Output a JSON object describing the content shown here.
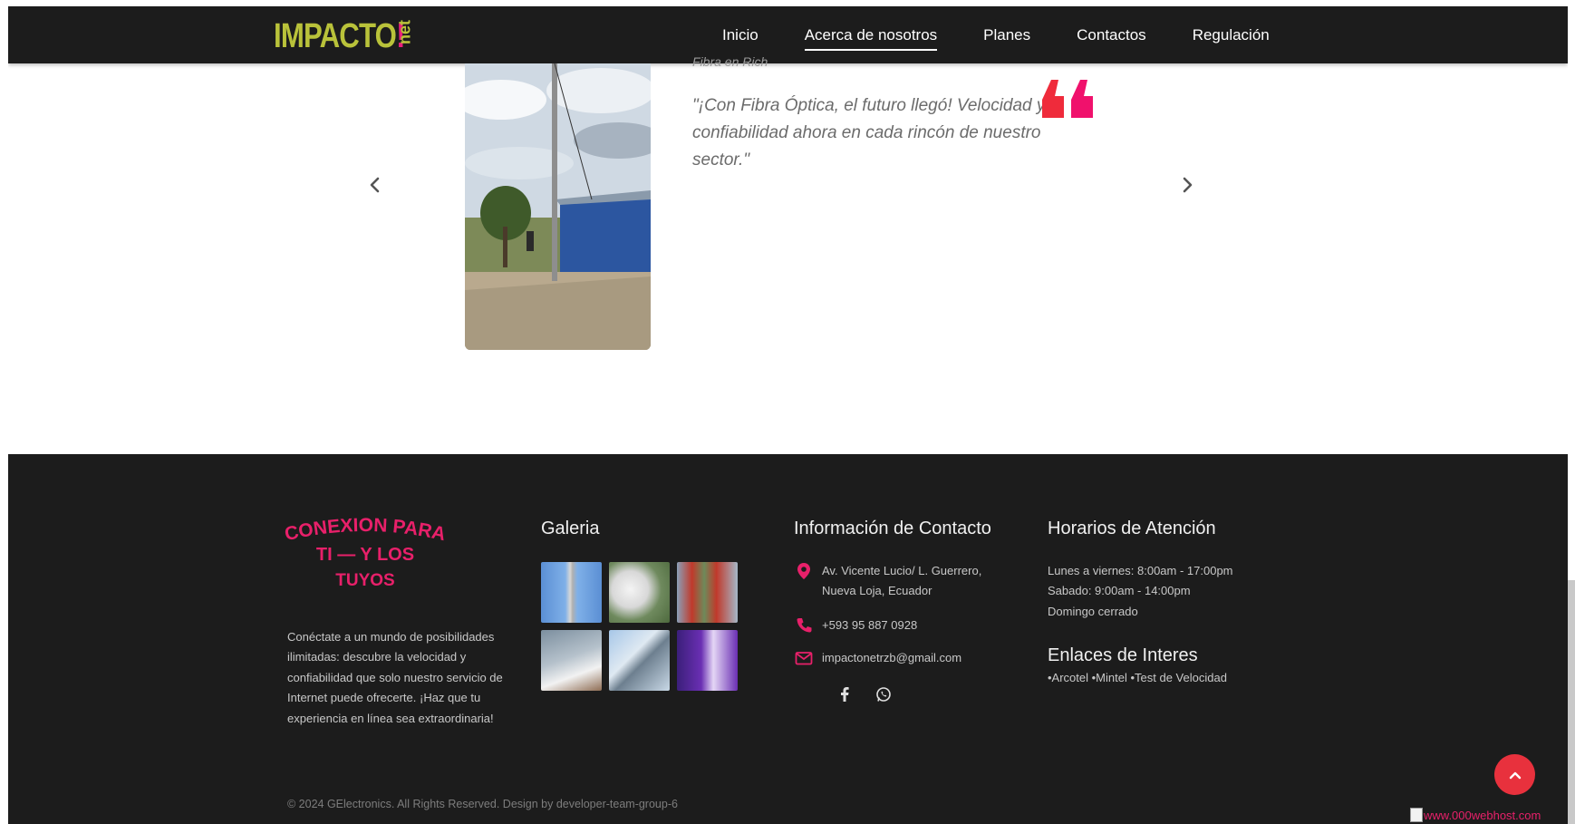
{
  "colors": {
    "nav_bg": "#1c1c1c",
    "footer_bg": "#1c1c1c",
    "brand_green": "#b9c23a",
    "brand_pink": "#e8207a",
    "accent_red": "#e8313d",
    "quote_mark_red": "#ef2b3b",
    "quote_mark_pink": "#f0116c"
  },
  "nav": {
    "logo_text": "IMPACTO",
    "logo_bang": "!",
    "logo_suffix": "net",
    "links": [
      {
        "label": "Inicio",
        "active": false
      },
      {
        "label": "Acerca de nosotros",
        "active": true
      },
      {
        "label": "Planes",
        "active": false
      },
      {
        "label": "Contactos",
        "active": false
      },
      {
        "label": "Regulación",
        "active": false
      }
    ]
  },
  "testimonial": {
    "cut_label": "Fibra en Rich",
    "quote": "\"¡Con Fibra Óptica, el futuro llegó! Velocidad y confiabilidad ahora en cada rincón de nuestro sector.\"",
    "quote_icon": "quote-mark-icon",
    "prev_icon": "chevron-left-icon",
    "next_icon": "chevron-right-icon"
  },
  "footer": {
    "tagline_lines": [
      "CONEXION PARA",
      "TI — Y LOS",
      "TUYOS"
    ],
    "about": "Conéctate a un mundo de posibilidades ilimitadas: descubre la velocidad y confiabilidad que solo nuestro servicio de Internet puede ofrecerte. ¡Haz que tu experiencia en línea sea extraordinaria!",
    "gallery_title": "Galeria",
    "gallery_items": [
      "tower-photo",
      "antenna-dish-photo",
      "mast-photo",
      "dish-sky-photo",
      "tower-clouds-photo",
      "promo-flyer-photo"
    ],
    "contact_title": "Información de Contacto",
    "address": "Av. Vicente Lucio/ L. Guerrero, Nueva Loja, Ecuador",
    "phone": "+593 95 887 0928",
    "email": "impactonetrzb@gmail.com",
    "social": [
      "facebook-icon",
      "whatsapp-icon"
    ],
    "hours_title": "Horarios de Atención",
    "hours": [
      "Lunes a viernes: 8:00am - 17:00pm",
      "Sabado: 9:00am - 14:00pm",
      "Domingo cerrado"
    ],
    "links_title": "Enlaces de Interes",
    "links_text": "•Arcotel •Mintel •Test de Velocidad",
    "copyright": "© 2024 GElectronics. All Rights Reserved. Design by developer-team-group-6",
    "hosting_text": "www.000webhost.com"
  }
}
